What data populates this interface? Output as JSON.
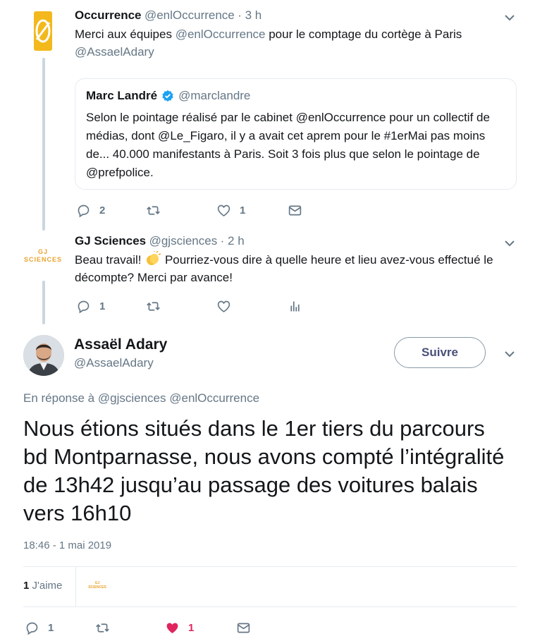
{
  "tweet1": {
    "name": "Occurrence",
    "handle": "@enlOccurrence",
    "time": "· 3 h",
    "text_prefix": "Merci aux équipes ",
    "text_mention": "@enlOccurrence",
    "text_suffix": " pour le comptage du cortège à Paris",
    "text_mention2": "@AssaelAdary",
    "logo_color": "#f3b81c",
    "quote": {
      "name": "Marc Landré",
      "handle": "@marclandre",
      "verified": true,
      "text": "Selon le pointage réalisé par le cabinet @enlOccurrence pour un collectif de médias, dont @Le_Figaro, il y a avait cet aprem pour le #1erMai pas moins de... 40.000 manifestants à Paris. Soit 3 fois plus que selon le pointage de @prefpolice."
    },
    "actions": {
      "reply_count": "2",
      "retweet_count": "",
      "like_count": "1"
    }
  },
  "tweet2": {
    "name": "GJ Sciences",
    "handle": "@gjsciences",
    "time": "· 2 h",
    "logo_top": "GJ",
    "logo_bottom": "SCIENCES",
    "text_line1": "Beau travail!",
    "text_line1b": " Pourriez-vous dire à quelle heure et lieu avez-vous effectué le",
    "text_line2": "décompte? Merci par avance!",
    "actions": {
      "reply_count": "1",
      "retweet_count": "",
      "like_count": ""
    }
  },
  "main_tweet": {
    "name": "Assaël Adary",
    "handle": "@AssaelAdary",
    "follow_label": "Suivre",
    "reply_to_prefix": "En réponse à ",
    "reply_to_1": "@gjsciences",
    "reply_to_2": "@enlOccurrence",
    "text": "Nous étions situés dans le 1er tiers du parcours bd Montparnasse, nous avons compté l’intégralité de 13h42 jusqu’au passage des voitures balais vers 16h10",
    "timestamp": "18:46 - 1 mai 2019",
    "likes_count": "1",
    "likes_label": "J'aime",
    "liker_logo_top": "GJ",
    "liker_logo_bottom": "SCIENCES",
    "actions": {
      "reply_count": "1",
      "retweet_count": "",
      "like_count": "1"
    }
  },
  "colors": {
    "like_active": "#e0245e",
    "verified": "#1da1f2",
    "icon_gray": "#657786",
    "gj_orange": "#e8a32e"
  }
}
